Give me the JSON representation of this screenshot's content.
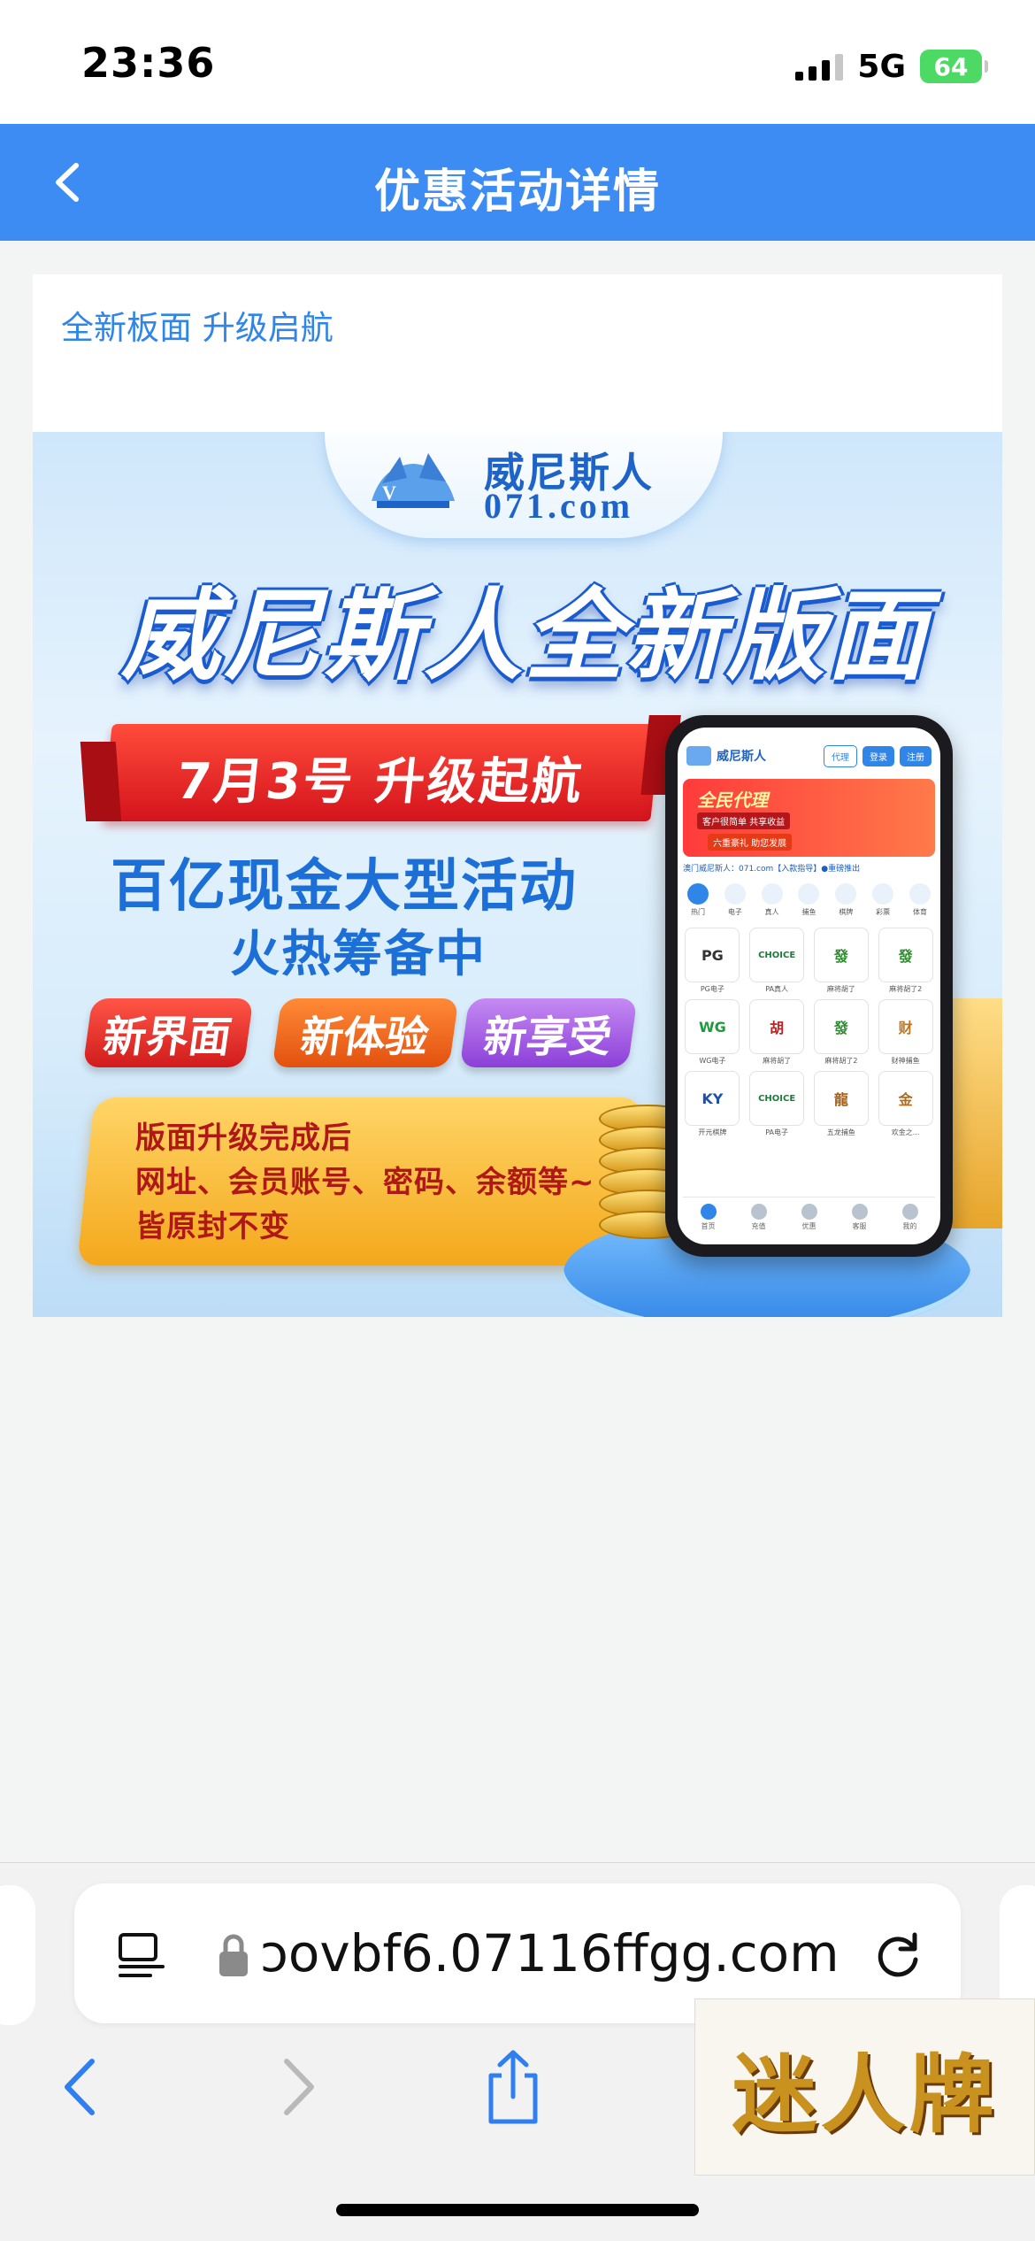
{
  "status_bar": {
    "time": "23:36",
    "network": "5G",
    "battery": "64"
  },
  "header": {
    "title": "优惠活动详情"
  },
  "promotion": {
    "subtitle": "全新板面 升级启航",
    "banner": {
      "brand_name": "威尼斯人",
      "brand_domain": "071.com",
      "headline": "威尼斯人全新版面",
      "ribbon": "7月3号  升级起航",
      "line1": "百亿现金大型活动",
      "line2": "火热筹备中",
      "tags": [
        "新界面",
        "新体验",
        "新享受"
      ],
      "notice_lines": [
        "版面升级完成后",
        "网址、会员账号、密码、余额等~",
        "皆原封不变"
      ]
    },
    "phone_mockup": {
      "brand": "威尼斯人",
      "buttons": [
        "代理",
        "登录",
        "注册"
      ],
      "banner_title": "全民代理",
      "banner_sub": "客户很简单 共享收益",
      "banner_sub2": "六重豪礼 助您发展",
      "notice": "澳门威尼斯人：071.com【入款指导】●重磅推出",
      "categories": [
        "热门",
        "电子",
        "真人",
        "捕鱼",
        "棋牌",
        "彩票",
        "体育"
      ],
      "tiles": [
        {
          "label": "PG电子",
          "img": "PG",
          "color": "#333333"
        },
        {
          "label": "PA真人",
          "img": "CHOICE",
          "color": "#1b7d3a"
        },
        {
          "label": "麻将胡了",
          "img": "發",
          "color": "#2e8a2e"
        },
        {
          "label": "麻将胡了2",
          "img": "發",
          "color": "#2e8a2e"
        },
        {
          "label": "WG电子",
          "img": "WG",
          "color": "#1e9b3e"
        },
        {
          "label": "麻将胡了",
          "img": "胡",
          "color": "#c02020"
        },
        {
          "label": "麻将胡了2",
          "img": "發",
          "color": "#2e8a2e"
        },
        {
          "label": "财神捕鱼",
          "img": "财",
          "color": "#c0761c"
        },
        {
          "label": "开元棋牌",
          "img": "KY",
          "color": "#1e4fb0"
        },
        {
          "label": "PA电子",
          "img": "CHOICE",
          "color": "#1b7d3a"
        },
        {
          "label": "五龙捕鱼",
          "img": "龍",
          "color": "#a0601a"
        },
        {
          "label": "欢金之...",
          "img": "金",
          "color": "#b06a1a"
        }
      ],
      "tabs": [
        "首页",
        "充值",
        "优惠",
        "客服",
        "我的"
      ]
    }
  },
  "browser": {
    "url": "ɔovbf6.07116ffgg.com"
  },
  "watermark": "迷人牌"
}
